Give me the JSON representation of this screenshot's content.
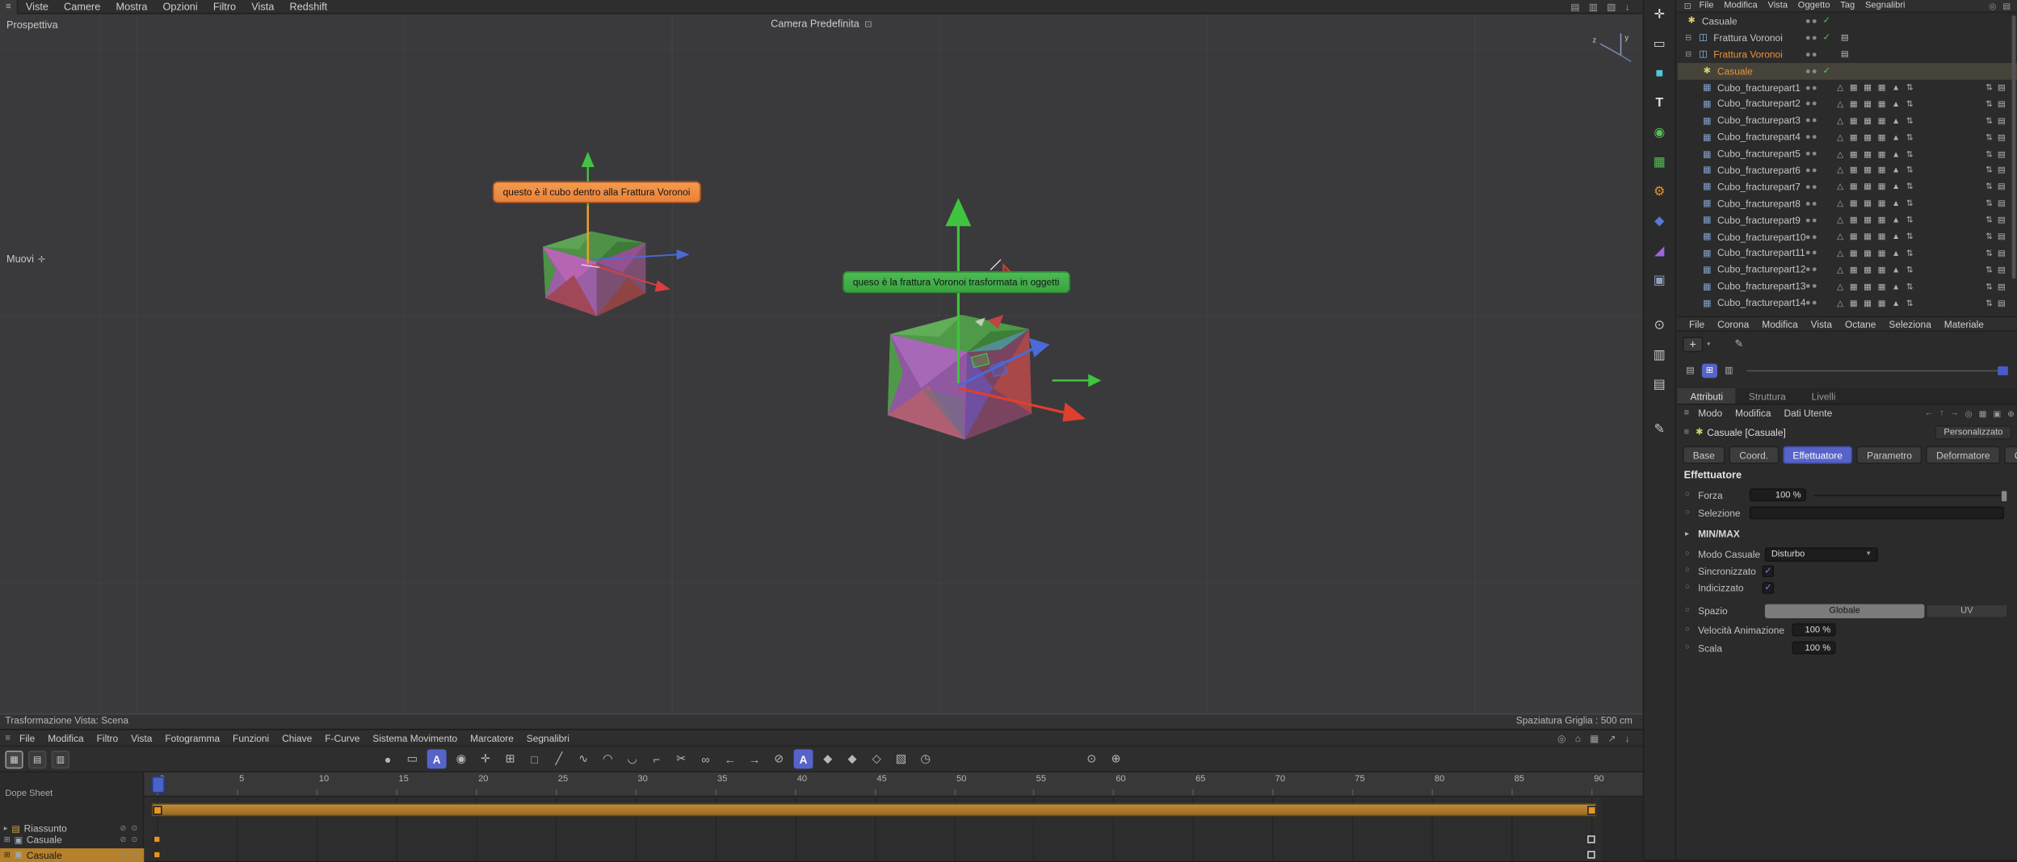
{
  "app": {
    "menubar": [
      "Viste",
      "Camere",
      "Mostra",
      "Opzioni",
      "Filtro",
      "Vista",
      "Redshift"
    ],
    "menubar_icons": [
      {
        "name": "palette-icon",
        "g": "▤"
      },
      {
        "name": "layout-icon",
        "g": "▥"
      },
      {
        "name": "snap-settings-icon",
        "g": "▧"
      },
      {
        "name": "download-icon",
        "g": "↓"
      }
    ]
  },
  "colors": {
    "accent_orange": "#e8821e",
    "accent_blue": "#5663c8",
    "tooltip_orange": "#ee8a3c",
    "tooltip_green": "#3fae46",
    "key_orange": "#e8942c",
    "summary_bar": "#b5812b",
    "check_green": "#5ec85e"
  },
  "viewport": {
    "view_name": "Prospettiva",
    "camera_label": "Camera Predefinita",
    "camera_icon": "⊡",
    "tool_hint": "Muovi",
    "tool_hint_icon": "✛",
    "status_left": "Trasformazione Vista: Scena",
    "status_right": "Spaziatura Griglia : 500 cm",
    "tooltip_cube1": "questo è il cubo dentro alla Frattura Voronoi",
    "tooltip_cube2": "queso è la frattura Voronoi trasformata in oggetti",
    "axis_y_label": "y",
    "axis_z_label": "z"
  },
  "left_toolbar": {
    "tools": [
      {
        "name": "move-tool-icon",
        "glyph": "✛",
        "style": "color:#e8e8e8"
      },
      {
        "name": "selection-frame-icon",
        "glyph": "▭",
        "style": "color:#d8d8d8"
      },
      {
        "name": "cube-primitive-icon",
        "glyph": "■",
        "style": "color:#4fc8d8"
      },
      {
        "name": "text-spline-icon",
        "glyph": "T",
        "style": "color:#e0e0e0;font-weight:bold"
      },
      {
        "name": "subdivision-surface-icon",
        "glyph": "◉",
        "style": "color:#53c053"
      },
      {
        "name": "mograph-icon",
        "glyph": "▦",
        "style": "color:#53c053"
      },
      {
        "name": "volume-gear-icon",
        "glyph": "⚙",
        "style": "color:#e89028"
      },
      {
        "name": "field-icon",
        "glyph": "◆",
        "style": "color:#5878d8"
      },
      {
        "name": "deformer-icon",
        "glyph": "◢",
        "style": "color:#9a68d8"
      },
      {
        "name": "scene-objects-icon",
        "glyph": "▣",
        "style": "color:#8aa0c0"
      },
      {
        "name": "camera-icon",
        "glyph": "⊙",
        "style": "color:#c8c8c8",
        "gap": true
      },
      {
        "name": "render-display-icon",
        "glyph": "▥",
        "style": "color:#c8c8c8"
      },
      {
        "name": "display-mode-icon",
        "glyph": "▤",
        "style": "color:#c8c8c8"
      },
      {
        "name": "pencil-tool-icon",
        "glyph": "✎",
        "style": "color:#c8c8c8",
        "gap": true
      }
    ]
  },
  "object_manager": {
    "menu": [
      "File",
      "Modifica",
      "Vista",
      "Oggetto",
      "Tag",
      "Segnalibri"
    ],
    "right_icons": [
      {
        "name": "search-icon",
        "g": "◎"
      },
      {
        "name": "filter-icon",
        "g": "▤"
      }
    ],
    "tag_strip": "△ ▦ ▦ ▦ ▲ ⇅",
    "far_strip": "⇅ ▤",
    "items": [
      {
        "name": "Casuale",
        "type": "random",
        "check": true
      },
      {
        "name": "Frattura Voronoi",
        "type": "voronoi",
        "expand": true,
        "check": true,
        "doc": true
      },
      {
        "name": "Frattura Voronoi",
        "type": "voronoi",
        "expand": true,
        "doc": true,
        "orange": true
      },
      {
        "name": "Casuale",
        "type": "random",
        "ind1": true,
        "check": true,
        "orange": true,
        "rowsel": true
      },
      {
        "name": "Cubo_fracturepart1",
        "type": "cube",
        "ind1": true,
        "tags": true
      },
      {
        "name": "Cubo_fracturepart2",
        "type": "cube",
        "ind1": true,
        "tags": true
      },
      {
        "name": "Cubo_fracturepart3",
        "type": "cube",
        "ind1": true,
        "tags": true
      },
      {
        "name": "Cubo_fracturepart4",
        "type": "cube",
        "ind1": true,
        "tags": true
      },
      {
        "name": "Cubo_fracturepart5",
        "type": "cube",
        "ind1": true,
        "tags": true
      },
      {
        "name": "Cubo_fracturepart6",
        "type": "cube",
        "ind1": true,
        "tags": true
      },
      {
        "name": "Cubo_fracturepart7",
        "type": "cube",
        "ind1": true,
        "tags": true
      },
      {
        "name": "Cubo_fracturepart8",
        "type": "cube",
        "ind1": true,
        "tags": true
      },
      {
        "name": "Cubo_fracturepart9",
        "type": "cube",
        "ind1": true,
        "tags": true
      },
      {
        "name": "Cubo_fracturepart10",
        "type": "cube",
        "ind1": true,
        "tags": true
      },
      {
        "name": "Cubo_fracturepart11",
        "type": "cube",
        "ind1": true,
        "tags": true
      },
      {
        "name": "Cubo_fracturepart12",
        "type": "cube",
        "ind1": true,
        "tags": true
      },
      {
        "name": "Cubo_fracturepart13",
        "type": "cube",
        "ind1": true,
        "tags": true
      },
      {
        "name": "Cubo_fracturepart14",
        "type": "cube",
        "ind1": true,
        "tags": true
      }
    ]
  },
  "material_manager": {
    "menu": [
      "File",
      "Corona",
      "Modifica",
      "Vista",
      "Octane",
      "Seleziona",
      "Materiale"
    ],
    "add_label": "+",
    "view_icons": [
      {
        "name": "list-view-icon",
        "g": "▤"
      },
      {
        "name": "grid-view-icon",
        "g": "⊞",
        "active": true
      },
      {
        "name": "detail-view-icon",
        "g": "▥"
      }
    ]
  },
  "attribute_manager": {
    "panel_tabs": [
      {
        "label": "Attributi",
        "active": true
      },
      {
        "label": "Struttura"
      },
      {
        "label": "Livelli"
      }
    ],
    "mode_menu": [
      "Modo",
      "Modifica",
      "Dati Utente"
    ],
    "mode_icons": [
      {
        "name": "back-icon",
        "g": "←"
      },
      {
        "name": "up-icon",
        "g": "↑"
      },
      {
        "name": "forward-icon",
        "g": "→"
      },
      {
        "name": "search-icon",
        "g": "◎"
      },
      {
        "name": "grid-icon",
        "g": "▦"
      },
      {
        "name": "lock-icon",
        "g": "▣"
      },
      {
        "name": "add-icon",
        "g": "⊕"
      }
    ],
    "object_title": "Casuale [Casuale]",
    "preset_label": "Personalizzato",
    "section_tabs": [
      {
        "label": "Base"
      },
      {
        "label": "Coord."
      },
      {
        "label": "Effettuatore",
        "active": true
      },
      {
        "label": "Parametro"
      },
      {
        "label": "Deformatore"
      },
      {
        "label": "Campi"
      }
    ],
    "section_heading": "Effettuatore",
    "rows": {
      "forza": {
        "label": "Forza",
        "value": "100 %"
      },
      "selezione": {
        "label": "Selezione",
        "value": ""
      },
      "minmax": {
        "label": "MIN/MAX"
      },
      "modo_casuale": {
        "label": "Modo Casuale",
        "value": "Disturbo"
      },
      "sincronizzato": {
        "label": "Sincronizzato",
        "checked": true,
        "check_glyph": "✓"
      },
      "indicizzato": {
        "label": "Indicizzato",
        "checked": true,
        "check_glyph": "✓"
      },
      "spazio": {
        "label": "Spazio",
        "options": [
          "Globale",
          "UV"
        ],
        "selected": "Globale"
      },
      "velocita": {
        "label": "Velocità Animazione",
        "value": "100 %"
      },
      "scala": {
        "label": "Scala",
        "value": "100 %"
      }
    }
  },
  "timeline": {
    "menu": [
      "File",
      "Modifica",
      "Filtro",
      "Vista",
      "Fotogramma",
      "Funzioni",
      "Chiave",
      "F-Curve",
      "Sistema Movimento",
      "Marcatore",
      "Segnalibri"
    ],
    "menu_right_icons": [
      {
        "name": "search-icon",
        "g": "◎"
      },
      {
        "name": "home-icon",
        "g": "⌂"
      },
      {
        "name": "grid-icon",
        "g": "▦"
      },
      {
        "name": "popout-icon",
        "g": "↗"
      },
      {
        "name": "dock-icon",
        "g": "↓"
      }
    ],
    "panel_label": "Dope Sheet",
    "frame_start": 0,
    "frame_end": 90,
    "tick_step": 5,
    "ruler_labels": [
      "0",
      "5",
      "10",
      "15",
      "20",
      "25",
      "30",
      "35",
      "40",
      "45",
      "50",
      "55",
      "60",
      "65",
      "70",
      "75",
      "80",
      "85",
      "90"
    ],
    "playhead_frame": 0,
    "mode_buttons": [
      {
        "name": "dope-sheet-mode",
        "g": "▦",
        "active": true
      },
      {
        "name": "fcurve-mode",
        "g": "▤"
      },
      {
        "name": "motion-mode",
        "g": "▥"
      }
    ],
    "toolbar_icons": [
      {
        "name": "sphere-icon",
        "g": "●"
      },
      {
        "name": "region-icon",
        "g": "▭"
      },
      {
        "name": "automatic-mode-button",
        "g": "A",
        "a": true
      },
      {
        "name": "motion-icon",
        "g": "◉"
      },
      {
        "name": "move-keys-icon",
        "g": "✛"
      },
      {
        "name": "snap-icon",
        "g": "⊞"
      },
      {
        "name": "frame-icon",
        "g": "□"
      },
      {
        "name": "linear-icon",
        "g": "╱"
      },
      {
        "name": "spline-icon",
        "g": "∿"
      },
      {
        "name": "ease-in-icon",
        "g": "◠"
      },
      {
        "name": "ease-out-icon",
        "g": "◡"
      },
      {
        "name": "step-icon",
        "g": "⌐"
      },
      {
        "name": "cut-keys-icon",
        "g": "✂"
      },
      {
        "name": "link-icon",
        "g": "∞"
      },
      {
        "name": "prev-key-icon",
        "g": "←"
      },
      {
        "name": "next-key-icon",
        "g": "→"
      },
      {
        "name": "zero-icon",
        "g": "⊘"
      },
      {
        "name": "autokey-button",
        "g": "A",
        "a": true
      },
      {
        "name": "key-diamond-icon",
        "g": "◆"
      },
      {
        "name": "key-diamond2-icon",
        "g": "◆"
      },
      {
        "name": "key-hollow-icon",
        "g": "◇"
      },
      {
        "name": "ramp-icon",
        "g": "▧"
      },
      {
        "name": "clock-icon",
        "g": "◷"
      },
      {
        "name": "lamp-icon",
        "g": "⊙",
        "sp": true
      },
      {
        "name": "add-key-icon",
        "g": "⊕"
      }
    ],
    "tracks": [
      {
        "name": "Riassunto",
        "type": "summary",
        "keys": [
          0,
          90
        ]
      },
      {
        "name": "Casuale",
        "keys": [
          0,
          90
        ]
      },
      {
        "name": "Casuale",
        "keys": [
          0,
          90
        ],
        "selected": true
      }
    ],
    "track_vis_icons": "⊘ ⊙"
  }
}
